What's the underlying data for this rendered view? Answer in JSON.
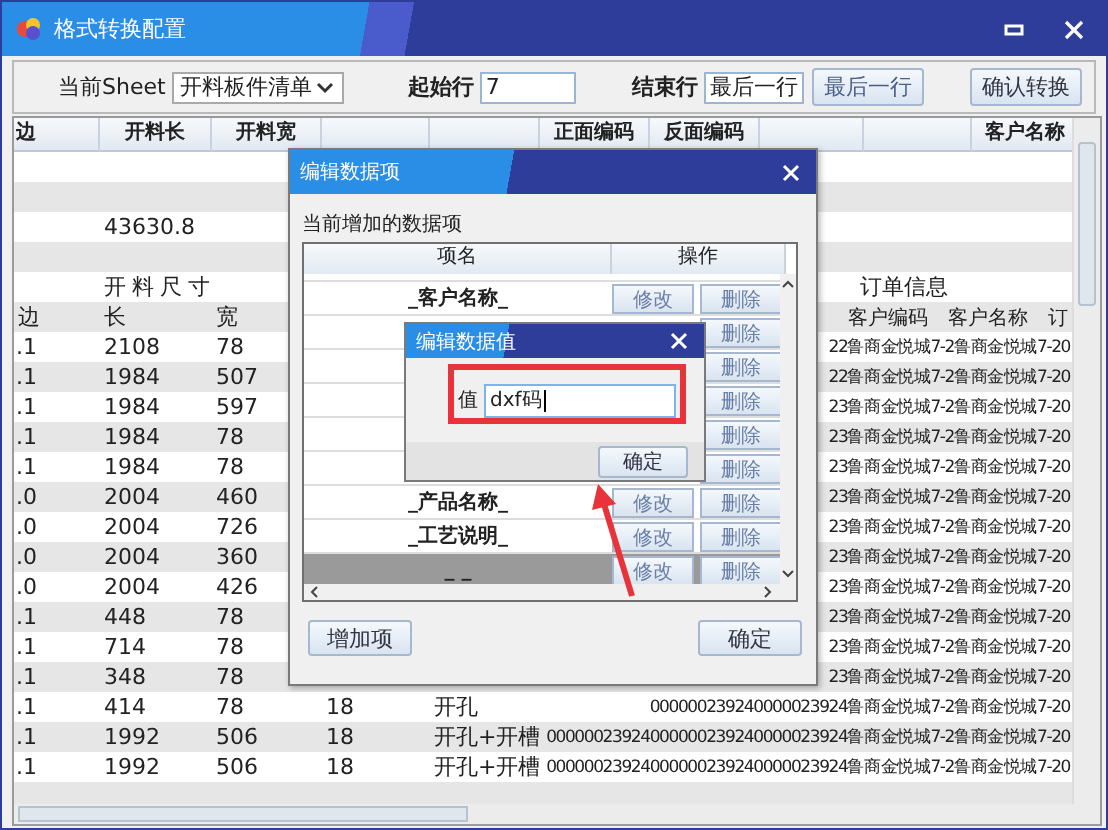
{
  "window": {
    "title": "格式转换配置"
  },
  "toolbar": {
    "sheet_label": "当前Sheet",
    "sheet_value": "开料板件清单",
    "start_label": "起始行",
    "start_value": "7",
    "end_label": "结束行",
    "end_value": "最后一行",
    "last_row_button": "最后一行",
    "confirm_button": "确认转换"
  },
  "grid": {
    "columns": [
      {
        "label": "边"
      },
      {
        "label": "开料长"
      },
      {
        "label": "开料宽"
      },
      {},
      {},
      {
        "label": "正面编码"
      },
      {
        "label": "反面编码"
      },
      {},
      {},
      {
        "label": "客户名称"
      }
    ],
    "rows": [
      {
        "kind": "empty"
      },
      {
        "kind": "empty"
      },
      {
        "kind": "total",
        "value": "43630.8"
      },
      {
        "kind": "empty"
      },
      {
        "kind": "group",
        "left": "开料尺寸",
        "right": "订单信息"
      },
      {
        "kind": "subheader",
        "cells": [
          "边",
          "长",
          "宽"
        ],
        "right": [
          "客户编码",
          "客户名称",
          "订"
        ]
      },
      {
        "kind": "data",
        "cells": [
          ".1",
          "2108",
          "78"
        ],
        "tail": "22鲁商金悦城7-2鲁商金悦城7-20"
      },
      {
        "kind": "data",
        "cells": [
          ".1",
          "1984",
          "507"
        ],
        "tail": "22鲁商金悦城7-2鲁商金悦城7-20"
      },
      {
        "kind": "data",
        "cells": [
          ".1",
          "1984",
          "597"
        ],
        "tail": "23鲁商金悦城7-2鲁商金悦城7-20"
      },
      {
        "kind": "data",
        "cells": [
          ".1",
          "1984",
          "78"
        ],
        "tail": "23鲁商金悦城7-2鲁商金悦城7-20"
      },
      {
        "kind": "data",
        "cells": [
          ".1",
          "1984",
          "78"
        ],
        "tail": "23鲁商金悦城7-2鲁商金悦城7-20"
      },
      {
        "kind": "data",
        "cells": [
          ".0",
          "2004",
          "460"
        ],
        "tail": "23鲁商金悦城7-2鲁商金悦城7-20"
      },
      {
        "kind": "data",
        "cells": [
          ".0",
          "2004",
          "726"
        ],
        "tail": "23鲁商金悦城7-2鲁商金悦城7-20"
      },
      {
        "kind": "data",
        "cells": [
          ".0",
          "2004",
          "360"
        ],
        "tail": "23鲁商金悦城7-2鲁商金悦城7-20"
      },
      {
        "kind": "data",
        "cells": [
          ".0",
          "2004",
          "426"
        ],
        "tail": "23鲁商金悦城7-2鲁商金悦城7-20"
      },
      {
        "kind": "data",
        "cells": [
          ".1",
          "448",
          "78"
        ],
        "tail": "23鲁商金悦城7-2鲁商金悦城7-20"
      },
      {
        "kind": "data",
        "cells": [
          ".1",
          "714",
          "78"
        ],
        "tail": "23鲁商金悦城7-2鲁商金悦城7-20"
      },
      {
        "kind": "data",
        "cells": [
          ".1",
          "348",
          "78"
        ],
        "tail": "23鲁商金悦城7-2鲁商金悦城7-20"
      },
      {
        "kind": "data",
        "cells": [
          ".1",
          "414",
          "78",
          "18",
          "开孔"
        ],
        "tail": "000000239240000023924鲁商金悦城7-2鲁商金悦城7-20"
      },
      {
        "kind": "data",
        "cells": [
          ".1",
          "1992",
          "506",
          "18",
          "开孔+开槽"
        ],
        "tail": "00000023924000000239240000023924鲁商金悦城7-2鲁商金悦城7-20"
      },
      {
        "kind": "data",
        "cells": [
          ".1",
          "1992",
          "506",
          "18",
          "开孔+开槽"
        ],
        "tail": "00000023924000000239240000023924鲁商金悦城7-2鲁商金悦城7-20"
      },
      {
        "kind": "empty"
      }
    ]
  },
  "edit_items_dialog": {
    "title": "编辑数据项",
    "caption": "当前增加的数据项",
    "columns": [
      "项名",
      "操作"
    ],
    "rows": [
      {
        "name": "_客户名称_",
        "actions": [
          "修改",
          "删除"
        ],
        "selected": false
      },
      {
        "actions": [
          "删除"
        ],
        "selected": false
      },
      {
        "actions": [
          "删除"
        ],
        "selected": false
      },
      {
        "actions": [
          "删除"
        ],
        "selected": false
      },
      {
        "actions": [
          "删除"
        ],
        "selected": false
      },
      {
        "actions": [
          "删除"
        ],
        "selected": false
      },
      {
        "name": "_产品名称_",
        "actions": [
          "修改",
          "删除"
        ],
        "selected": false
      },
      {
        "name": "_工艺说明_",
        "actions": [
          "修改",
          "删除"
        ],
        "selected": false
      },
      {
        "name": "_ _",
        "actions": [
          "修改",
          "删除"
        ],
        "selected": true
      }
    ],
    "add_button": "增加项",
    "ok_button": "确定"
  },
  "edit_value_dialog": {
    "title": "编辑数据值",
    "label": "值",
    "value": "dxf码",
    "ok_button": "确定"
  }
}
